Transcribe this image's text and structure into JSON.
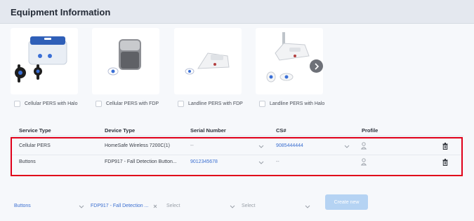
{
  "header": {
    "title": "Equipment Information"
  },
  "equipment_cards": [
    {
      "label": "Cellular PERS with Halo"
    },
    {
      "label": "Cellular PERS with FDP"
    },
    {
      "label": "Landline PERS with FDP"
    },
    {
      "label": "Landline PERS with Halo"
    }
  ],
  "table": {
    "headers": [
      "Service Type",
      "Device Type",
      "Serial Number",
      "CS#",
      "Profile"
    ],
    "rows": [
      {
        "service_type": "Cellular PERS",
        "device_type": "HomeSafe Wireless 7200C(1)",
        "serial_number": "--",
        "cs_number": "9085444444"
      },
      {
        "service_type": "Buttons",
        "device_type": "FDP917 - Fall Detection Button...",
        "serial_number": "9012345678",
        "cs_number": "--"
      }
    ]
  },
  "add_row": {
    "service_type": "Buttons",
    "device_type": "FDP917 - Fall Detection ...",
    "select_1": "Select",
    "select_2": "Select",
    "create_button": "Create new"
  },
  "colors": {
    "highlight": "#e0001a",
    "link": "#3b6fd0",
    "header_bg": "#e4e8ef",
    "button": "#b5d3f3"
  }
}
